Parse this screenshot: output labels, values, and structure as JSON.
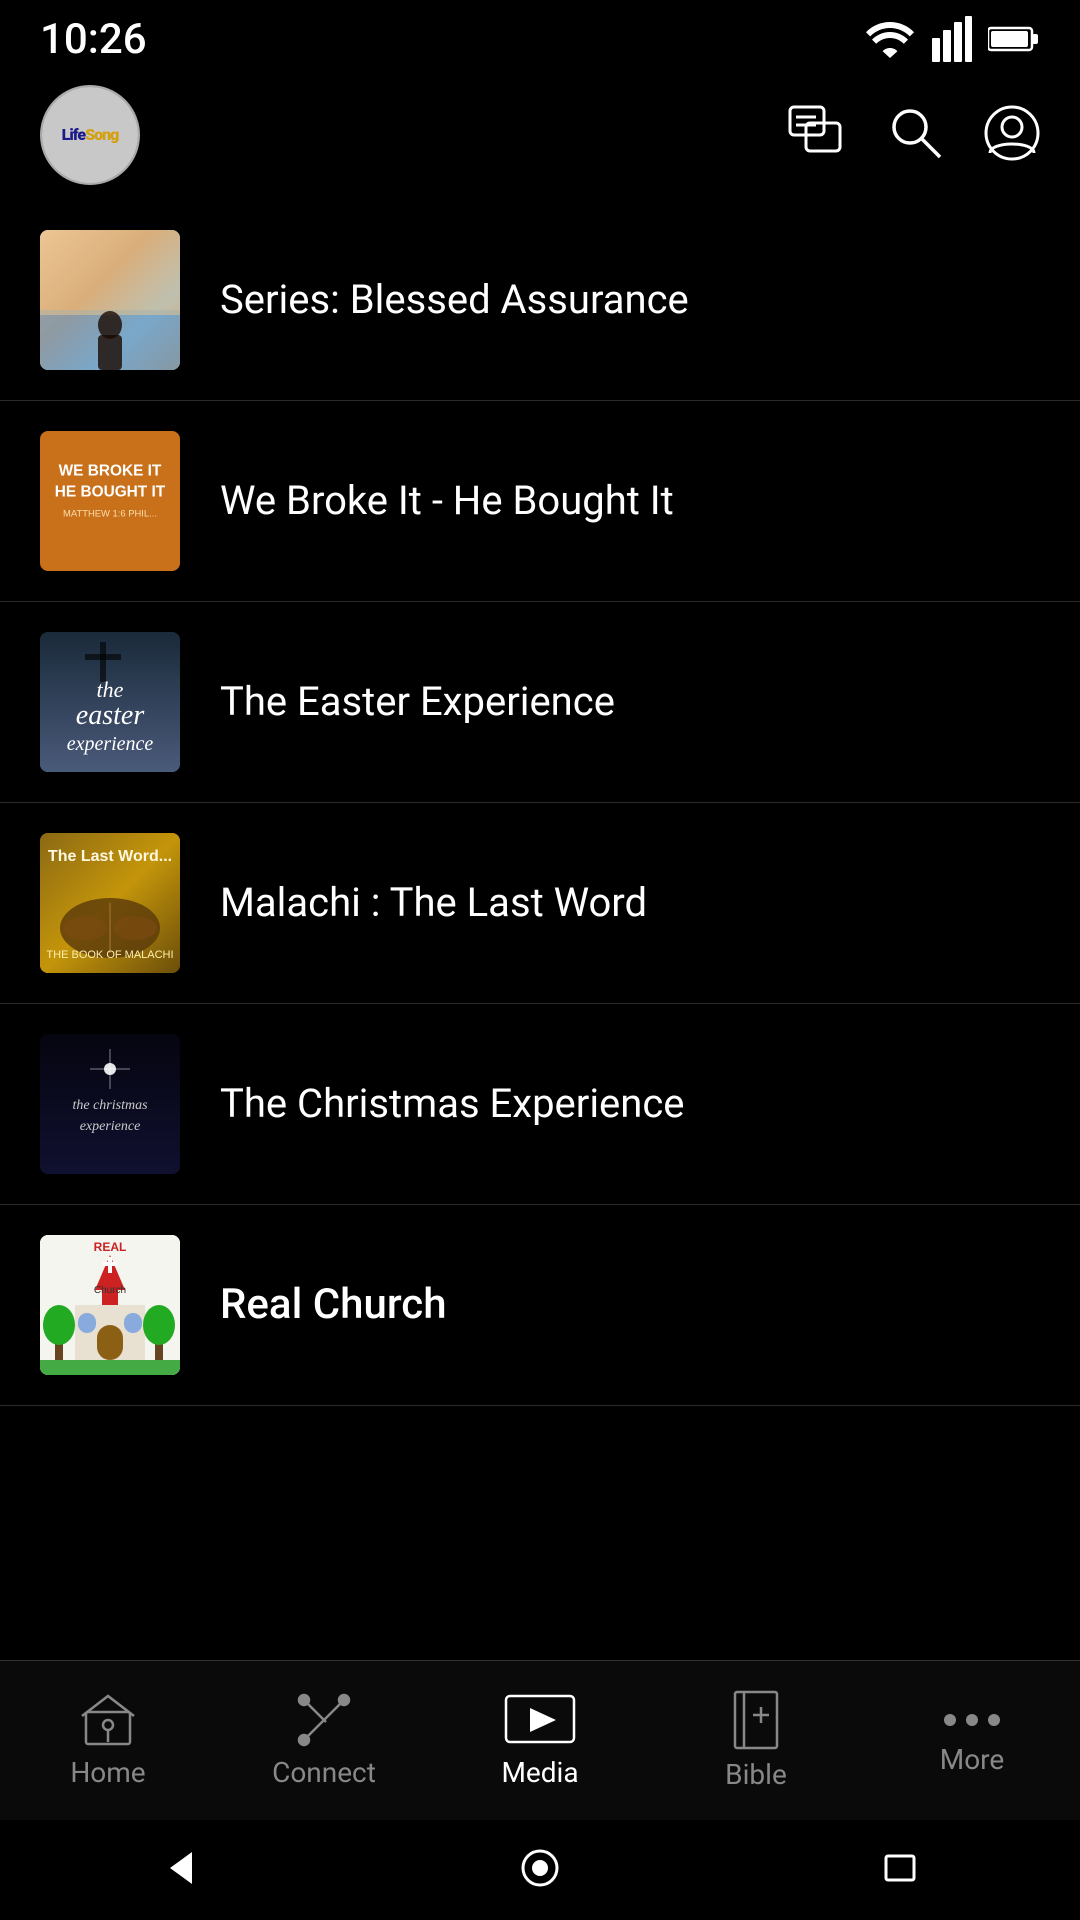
{
  "statusBar": {
    "time": "10:26"
  },
  "header": {
    "logoText": "LifeSong",
    "logoAlt": "LifeSong logo"
  },
  "listItems": [
    {
      "id": "blessed-assurance",
      "title": "Series: Blessed Assurance",
      "thumbType": "blessed"
    },
    {
      "id": "we-broke-it",
      "title": "We Broke It - He Bought It",
      "thumbType": "broke"
    },
    {
      "id": "easter-experience",
      "title": "The Easter Experience",
      "thumbType": "easter"
    },
    {
      "id": "malachi",
      "title": "Malachi : The Last Word",
      "thumbType": "malachi"
    },
    {
      "id": "christmas-experience",
      "title": "The Christmas Experience",
      "thumbType": "christmas"
    },
    {
      "id": "real-church",
      "title": "Real Church",
      "thumbType": "real-church",
      "partial": true
    }
  ],
  "bottomNav": {
    "items": [
      {
        "id": "home",
        "label": "Home",
        "active": false
      },
      {
        "id": "connect",
        "label": "Connect",
        "active": false
      },
      {
        "id": "media",
        "label": "Media",
        "active": true
      },
      {
        "id": "bible",
        "label": "Bible",
        "active": false
      },
      {
        "id": "more",
        "label": "More",
        "active": false
      }
    ]
  }
}
